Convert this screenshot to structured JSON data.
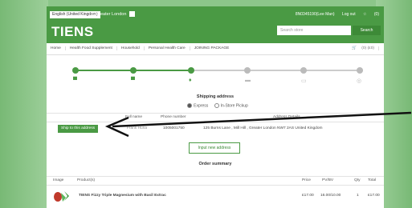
{
  "header": {
    "language": "English (United Kingdom)",
    "region": "Greater London",
    "account": "8N0345190(Lee Man)",
    "logout": "Log out",
    "wishlist": "(0)"
  },
  "brand": {
    "logo": "TIENS",
    "search_placeholder": "Search store",
    "search_button": "Search"
  },
  "nav": [
    "Home",
    "Health Food Supplement",
    "Household",
    "Personal Health Care",
    "JOINING PACKAGE"
  ],
  "cart": "(0) (£0)",
  "shipping": {
    "title": "Shipping address",
    "option_express": "Express",
    "option_pickup": "In-Store Pickup",
    "col_fullname": "Full name",
    "col_phone": "Phone number",
    "col_address": "Address Details",
    "ship_button": "Ship to this address",
    "fullname": "Frank Huna",
    "phone": "1005001750",
    "address": "125 Burns Lane , Mill Hill , Greater London NW7 2AS United Kingdom",
    "input_new": "Input new address"
  },
  "order": {
    "title": "Order summary",
    "cols": [
      "Image",
      "Product(s)",
      "Price",
      "PV/BV",
      "Qty",
      "Total"
    ],
    "product": "TIENS Fizzy Triple Magnesium with Basil Extrac",
    "price": "£17.00",
    "pvbv": "16.00/10.00",
    "qty": "1",
    "total": "£17.00"
  },
  "colors": {
    "brand_green": "#4a9a44",
    "background": "#8cc68a"
  }
}
